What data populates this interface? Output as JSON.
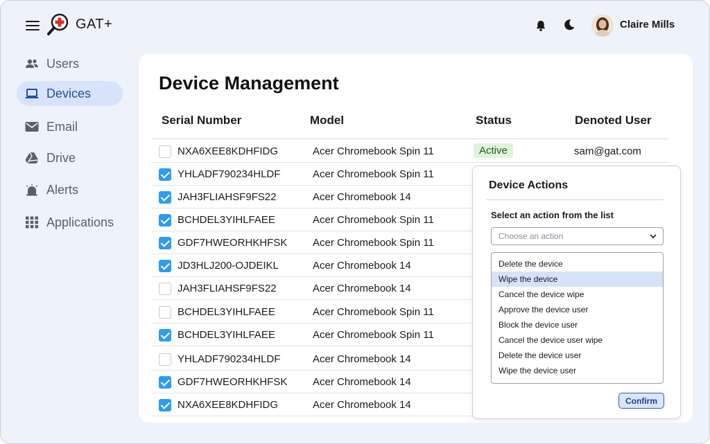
{
  "app": {
    "name": "GAT+"
  },
  "header": {
    "user_name": "Claire Mills"
  },
  "sidebar": {
    "items": [
      {
        "label": "Users",
        "icon": "users-icon",
        "active": false
      },
      {
        "label": "Devices",
        "icon": "laptop-icon",
        "active": true
      },
      {
        "label": "Email",
        "icon": "mail-icon",
        "active": false
      },
      {
        "label": "Drive",
        "icon": "drive-icon",
        "active": false
      },
      {
        "label": "Alerts",
        "icon": "alarm-icon",
        "active": false
      },
      {
        "label": "Applications",
        "icon": "apps-grid-icon",
        "active": false
      }
    ]
  },
  "main": {
    "title": "Device Management",
    "columns": [
      "Serial Number",
      "Model",
      "Status",
      "Denoted User"
    ],
    "rows": [
      {
        "checked": false,
        "serial": "NXA6XEE8KDHFIDG",
        "model": "Acer Chromebook Spin 11",
        "status": "Active",
        "user": "sam@gat.com"
      },
      {
        "checked": true,
        "serial": "YHLADF790234HLDF",
        "model": "Acer Chromebook Spin 11",
        "status": "",
        "user": ""
      },
      {
        "checked": true,
        "serial": "JAH3FLIAHSF9FS22",
        "model": "Acer Chromebook 14",
        "status": "",
        "user": ""
      },
      {
        "checked": true,
        "serial": "BCHDEL3YIHLFAEE",
        "model": "Acer Chromebook Spin 11",
        "status": "",
        "user": ""
      },
      {
        "checked": true,
        "serial": "GDF7HWEORHKHFSK",
        "model": "Acer Chromebook Spin 11",
        "status": "",
        "user": ""
      },
      {
        "checked": true,
        "serial": "JD3HLJ200-OJDEIKL",
        "model": "Acer Chromebook 14",
        "status": "",
        "user": ""
      },
      {
        "checked": false,
        "serial": "JAH3FLIAHSF9FS22",
        "model": "Acer Chromebook 14",
        "status": "",
        "user": ""
      },
      {
        "checked": false,
        "serial": "BCHDEL3YIHLFAEE",
        "model": "Acer Chromebook Spin 11",
        "status": "",
        "user": ""
      },
      {
        "checked": true,
        "serial": "BCHDEL3YIHLFAEE",
        "model": "Acer Chromebook Spin 11",
        "status": "",
        "user": ""
      },
      {
        "checked": false,
        "serial": "YHLADF790234HLDF",
        "model": "Acer Chromebook 14",
        "status": "",
        "user": ""
      },
      {
        "checked": true,
        "serial": "GDF7HWEORHKHFSK",
        "model": "Acer Chromebook 14",
        "status": "",
        "user": ""
      },
      {
        "checked": true,
        "serial": "NXA6XEE8KDHFIDG",
        "model": "Acer Chromebook 14",
        "status": "",
        "user": ""
      }
    ]
  },
  "popup": {
    "title": "Device Actions",
    "label": "Select an action from the list",
    "select_placeholder": "Choose an action",
    "options": [
      "Delete the device",
      "Wipe the device",
      "Cancel the device wipe",
      "Approve the device user",
      "Block the device user",
      "Cancel the device user wipe",
      "Delete the device user",
      "Wipe the device user"
    ],
    "selected_option": "Wipe the device",
    "confirm_label": "Confirm"
  },
  "colors": {
    "accent": "#2d9cf0",
    "active_nav_bg": "#d8e3fb",
    "status_active_bg": "#dff5d9",
    "logo_red": "#e02b2b"
  }
}
